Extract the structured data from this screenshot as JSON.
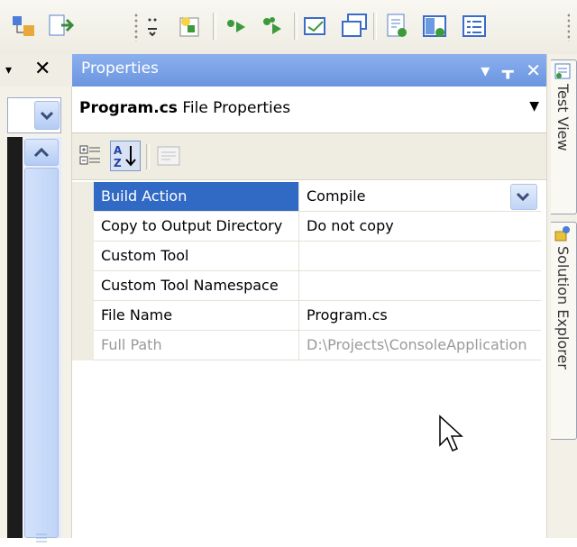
{
  "properties_window": {
    "title": "Properties",
    "title_buttons": {
      "dropdown": "▾",
      "pin": "ᚁ",
      "close": "✕"
    },
    "object": {
      "name": "Program.cs",
      "type": "File Properties"
    },
    "toolbar": {
      "categorized": "categorized-icon",
      "alphabetical": "alphabetical-icon",
      "property_pages": "property-pages-icon"
    },
    "rows": [
      {
        "name": "Build Action",
        "value": "Compile"
      },
      {
        "name": "Copy to Output Directory",
        "value": "Do not copy"
      },
      {
        "name": "Custom Tool",
        "value": ""
      },
      {
        "name": "Custom Tool Namespace",
        "value": ""
      },
      {
        "name": "File Name",
        "value": "Program.cs"
      },
      {
        "name": "Full Path",
        "value": "D:\\Projects\\ConsoleApplication"
      }
    ]
  },
  "left_panel": {
    "close": "✕"
  },
  "dock_tabs": [
    {
      "label": "Test View"
    },
    {
      "label": "Solution Explorer"
    }
  ],
  "colors": {
    "title_bar": "#7aa2e8",
    "selection": "#316ac5",
    "gutter": "#efede2"
  }
}
